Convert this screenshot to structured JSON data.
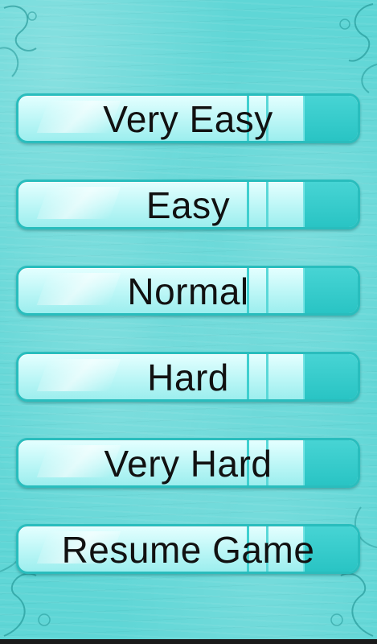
{
  "app": {
    "screen": "difficulty-menu"
  },
  "menu": {
    "items": [
      {
        "label": "Very Easy"
      },
      {
        "label": "Easy"
      },
      {
        "label": "Normal"
      },
      {
        "label": "Hard"
      },
      {
        "label": "Very Hard"
      },
      {
        "label": "Resume Game"
      }
    ]
  },
  "theme": {
    "background": "#5fd6d6",
    "button_border": "#29bdbd",
    "button_fill_top": "#e4ffff",
    "button_fill_bottom": "#9ceeee",
    "button_end": "#29c4c4",
    "text": "#111111"
  }
}
